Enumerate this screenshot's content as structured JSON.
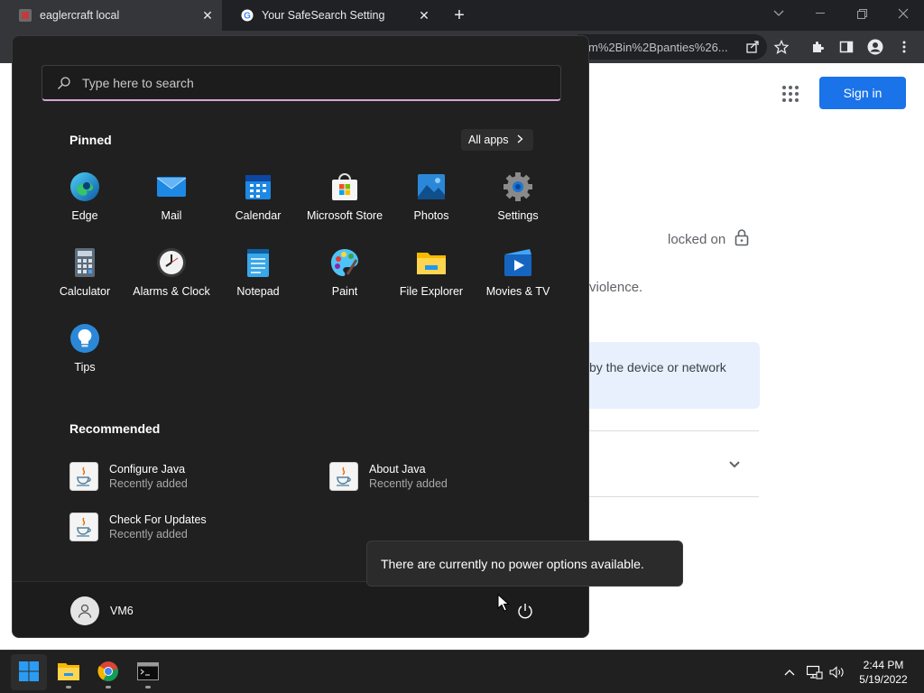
{
  "browser": {
    "tabs": [
      {
        "title": "eaglercraft local"
      },
      {
        "title": "Your SafeSearch Setting"
      }
    ],
    "url_fragment": "m%2Bin%2Bpanties%26..."
  },
  "page": {
    "signin_label": "Sign in",
    "locked_text": "locked on",
    "violence_text": "violence.",
    "notice_text": "by the device or network"
  },
  "start_menu": {
    "search_placeholder": "Type here to search",
    "pinned_title": "Pinned",
    "all_apps_label": "All apps",
    "pinned": [
      {
        "label": "Edge",
        "icon": "edge-icon"
      },
      {
        "label": "Mail",
        "icon": "mail-icon"
      },
      {
        "label": "Calendar",
        "icon": "calendar-icon"
      },
      {
        "label": "Microsoft Store",
        "icon": "store-icon"
      },
      {
        "label": "Photos",
        "icon": "photos-icon"
      },
      {
        "label": "Settings",
        "icon": "gear-icon"
      },
      {
        "label": "Calculator",
        "icon": "calculator-icon"
      },
      {
        "label": "Alarms & Clock",
        "icon": "clock-icon"
      },
      {
        "label": "Notepad",
        "icon": "notepad-icon"
      },
      {
        "label": "Paint",
        "icon": "palette-icon"
      },
      {
        "label": "File Explorer",
        "icon": "folder-icon"
      },
      {
        "label": "Movies & TV",
        "icon": "play-icon"
      },
      {
        "label": "Tips",
        "icon": "lightbulb-icon"
      }
    ],
    "recommended_title": "Recommended",
    "recommended": [
      {
        "name": "Configure Java",
        "sub": "Recently added"
      },
      {
        "name": "About Java",
        "sub": "Recently added"
      },
      {
        "name": "Check For Updates",
        "sub": "Recently added"
      }
    ],
    "user_name": "VM6",
    "power_tooltip": "There are currently no power options available."
  },
  "taskbar": {
    "time": "2:44 PM",
    "date": "5/19/2022"
  },
  "colors": {
    "accent_blue": "#1a73e8",
    "start_bg": "#202020",
    "search_underline": "#d7a3d2"
  }
}
